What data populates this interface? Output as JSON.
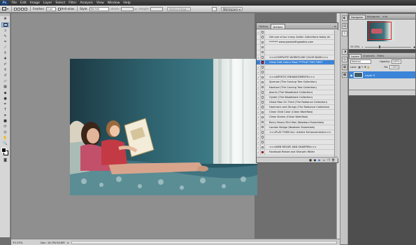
{
  "app": {
    "logo": "Ps"
  },
  "menu": [
    "File",
    "Edit",
    "Image",
    "Layer",
    "Select",
    "Filter",
    "Analysis",
    "View",
    "Window",
    "Help"
  ],
  "options": {
    "feather_label": "Feather:",
    "feather_value": "0 px",
    "antialias_label": "Anti-alias",
    "style_label": "Style:",
    "style_value": "Normal",
    "width_label": "Width:",
    "height_label": "Height:",
    "refine_label": "Refine Edge...",
    "workspace_label": "Workspace"
  },
  "actions_panel": {
    "tabs": [
      "History",
      "Actions"
    ],
    "rows": [
      {
        "text": "",
        "check": true,
        "dialog": false
      },
      {
        "text": "Get one of our many Action Collections today at:",
        "check": false,
        "dialog": false
      },
      {
        "text": "******* www.greatwithgoodies.com",
        "check": false,
        "dialog": false
      },
      {
        "text": "",
        "check": false,
        "dialog": false
      },
      {
        "text": "",
        "check": false,
        "dialog": false
      },
      {
        "text": "<<<COMPLETE WORKFLOW COLOR BASE>>>",
        "check": true,
        "dialog": false
      },
      {
        "text": "Clean Edit Colour Base  ***PLAY THIS FIRST",
        "check": true,
        "dialog": true,
        "selected": true
      },
      {
        "text": "",
        "check": true,
        "dialog": false
      },
      {
        "text": "",
        "check": true,
        "dialog": false
      },
      {
        "text": "<<<ARTISTIC ENHANCEMENTS>>>",
        "check": true,
        "dialog": false
      },
      {
        "text": "Sparrow    (The Carving Tree Collection)",
        "check": true,
        "dialog": false
      },
      {
        "text": "Nautical    (The Carving Tree Collection)",
        "check": true,
        "dialog": false
      },
      {
        "text": "Jasmin    (The Woodblock Collection)",
        "check": true,
        "dialog": false
      },
      {
        "text": "Oyster    (The Woodblock Collection)",
        "check": true,
        "dialog": false
      },
      {
        "text": "Ghost Man On Third    (The Radiance Collection)",
        "check": true,
        "dialog": false
      },
      {
        "text": "Hammers and Strings    (The Radiance Collection)",
        "check": true,
        "dialog": false
      },
      {
        "text": "Clean Vivid Color    (Clean Workflow)",
        "check": true,
        "dialog": false
      },
      {
        "text": "Clean Drama    (Clean Workflow)",
        "check": true,
        "dialog": false
      },
      {
        "text": "Berry Heavy Mini Max    (Newborn Essentials)",
        "check": true,
        "dialog": false
      },
      {
        "text": "London Bridge    (Newborn Essentials)",
        "check": true,
        "dialog": false
      },
      {
        "text": "<<<PLAY THEM ALL: Artistic Enhancements>>>",
        "check": true,
        "dialog": false
      },
      {
        "text": "",
        "check": true,
        "dialog": false
      },
      {
        "text": "",
        "check": true,
        "dialog": false
      },
      {
        "text": "<<<WEB RESIZE AND SHARPEN>>>",
        "check": true,
        "dialog": false
      },
      {
        "text": "Facebook Resize and Sharpen Wider",
        "check": true,
        "dialog": true
      }
    ],
    "footer_icons": [
      "stop-icon",
      "record-icon",
      "play-icon",
      "new-set-icon",
      "new-action-icon",
      "delete-icon"
    ]
  },
  "navigator": {
    "tabs": [
      "Navigator",
      "Histogram",
      "Info"
    ],
    "zoom": "33.33%"
  },
  "layers": {
    "tabs": [
      "Layers",
      "Channels",
      "Paths"
    ],
    "blend_mode": "Normal",
    "opacity_label": "Opacity:",
    "opacity": "100%",
    "lock_label": "Lock:",
    "fill_label": "Fill:",
    "fill": "100%",
    "layer_name": "Layer 0"
  },
  "status": {
    "zoom": "33.33%",
    "doc": "Doc: 16.7M/16.6M"
  },
  "colors": {
    "accent": "#3b84d8"
  }
}
